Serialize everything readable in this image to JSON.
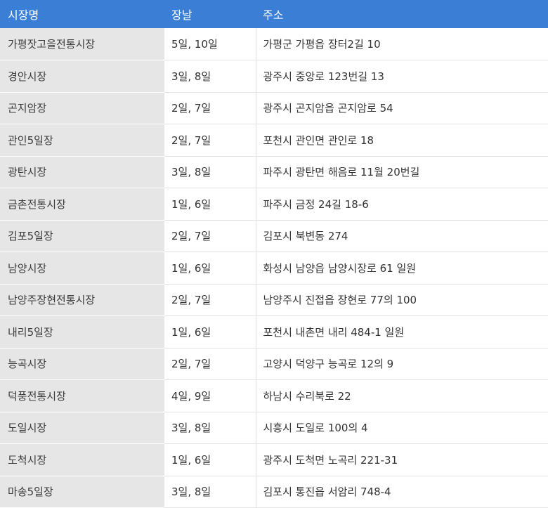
{
  "header": {
    "col1": "시장명",
    "col2": "장날",
    "col3": "주소"
  },
  "rows": [
    {
      "name": "가평잣고을전통시장",
      "day": "5일, 10일",
      "addr": "가평군 가평읍 장터2길 10"
    },
    {
      "name": "경안시장",
      "day": "3일, 8일",
      "addr": "광주시 중앙로 123번길 13"
    },
    {
      "name": "곤지암장",
      "day": "2일, 7일",
      "addr": "광주시 곤지암읍 곤지암로 54"
    },
    {
      "name": "관인5일장",
      "day": "2일, 7일",
      "addr": "포천시 관인면 관인로 18"
    },
    {
      "name": "광탄시장",
      "day": "3일, 8일",
      "addr": "파주시 광탄면 해음로 11월 20번길"
    },
    {
      "name": "금촌전통시장",
      "day": "1일, 6일",
      "addr": "파주시 금정 24길 18-6"
    },
    {
      "name": "김포5일장",
      "day": "2일, 7일",
      "addr": "김포시 북변동 274"
    },
    {
      "name": "남양시장",
      "day": "1일, 6일",
      "addr": "화성시 남양읍 남양시장로 61 일원"
    },
    {
      "name": "남양주장현전통시장",
      "day": "2일, 7일",
      "addr": "남양주시 진접읍 장현로 77의 100"
    },
    {
      "name": "내리5일장",
      "day": "1일, 6일",
      "addr": "포천시 내촌면 내리 484-1 일원"
    },
    {
      "name": "능곡시장",
      "day": "2일, 7일",
      "addr": "고양시 덕양구 능곡로 12의 9"
    },
    {
      "name": "덕풍전통시장",
      "day": "4일, 9일",
      "addr": "하남시 수리북로 22"
    },
    {
      "name": "도일시장",
      "day": "3일, 8일",
      "addr": "시흥시 도일로 100의 4"
    },
    {
      "name": "도척시장",
      "day": "1일, 6일",
      "addr": "광주시 도척면 노곡리 221-31"
    },
    {
      "name": "마송5일장",
      "day": "3일, 8일",
      "addr": "김포시 통진읍 서암리 748-4"
    }
  ]
}
